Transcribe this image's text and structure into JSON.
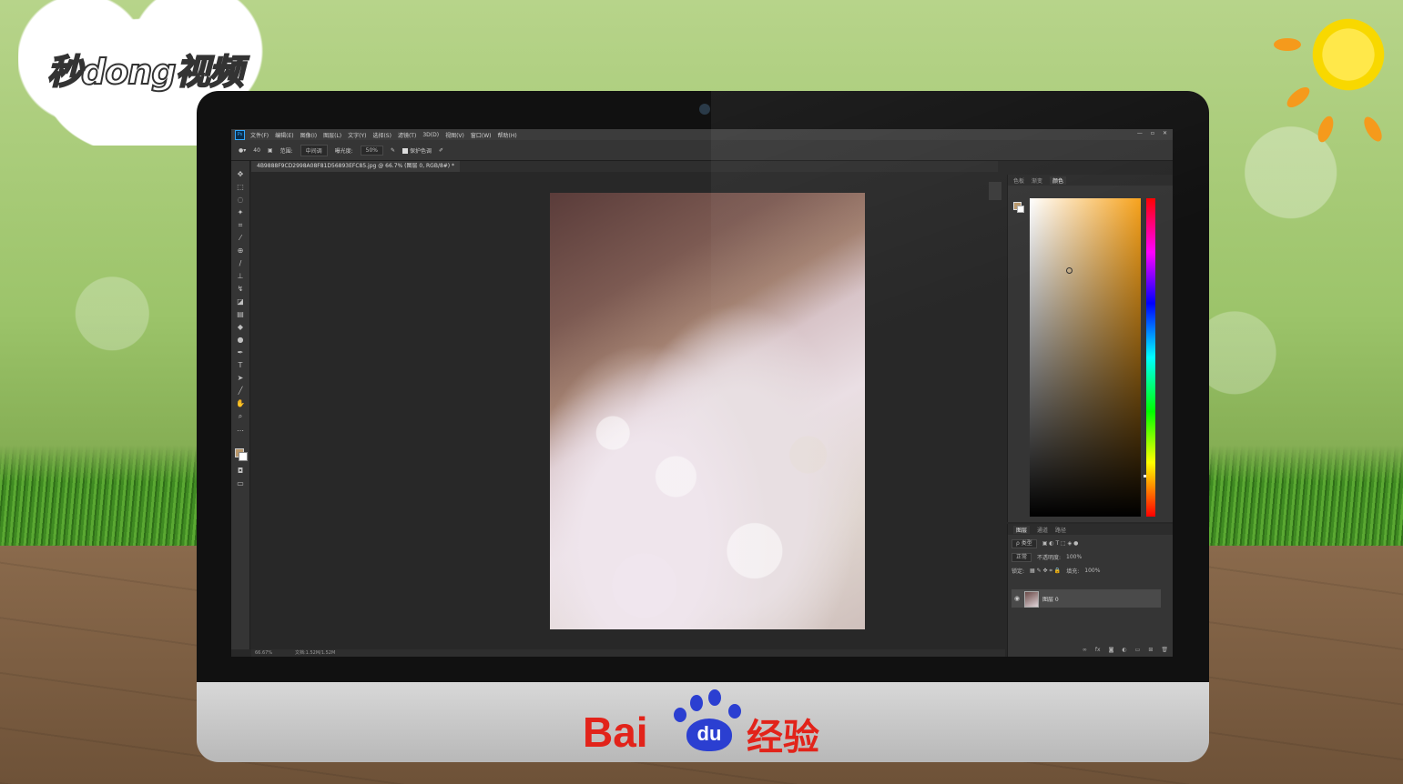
{
  "overlay": {
    "brand_logo": "秒dong视频",
    "baidu_text": "Bai",
    "baidu_du": "du",
    "baidu_jingyan": "经验"
  },
  "photoshop": {
    "app_icon": "Ps",
    "menu": [
      "文件(F)",
      "编辑(E)",
      "图像(I)",
      "图层(L)",
      "文字(Y)",
      "选择(S)",
      "滤镜(T)",
      "3D(D)",
      "视图(V)",
      "窗口(W)",
      "帮助(H)"
    ],
    "window_controls": [
      "—",
      "▫",
      "✕"
    ],
    "options": {
      "size": "40",
      "range_label": "范围:",
      "range_value": "中间调",
      "exposure_label": "曝光度:",
      "exposure_value": "50%",
      "protect_tones": "保护色调"
    },
    "document_tab": "4B9888F9CD2998A08F81D56893EFC85.jpg @ 66.7% (图层 0, RGB/8#) *",
    "status": {
      "zoom": "66.67%",
      "doc": "文档:1.52M/1.52M"
    },
    "color_panel": {
      "tabs": [
        "色板",
        "渐变",
        "颜色"
      ],
      "active_tab": "颜色"
    },
    "layers_panel": {
      "tabs": [
        "图层",
        "通道",
        "路径"
      ],
      "filter_label": "ρ 类型",
      "blend_mode": "正常",
      "opacity_label": "不透明度:",
      "opacity_value": "100%",
      "lock_label": "锁定:",
      "fill_label": "填充:",
      "fill_value": "100%",
      "layer_name": "图层 0"
    }
  },
  "colors": {
    "foreground": "#b8976a",
    "accent_orange": "#f7a21b",
    "baidu_red": "#e2231a",
    "baidu_blue": "#2b3fd1"
  }
}
